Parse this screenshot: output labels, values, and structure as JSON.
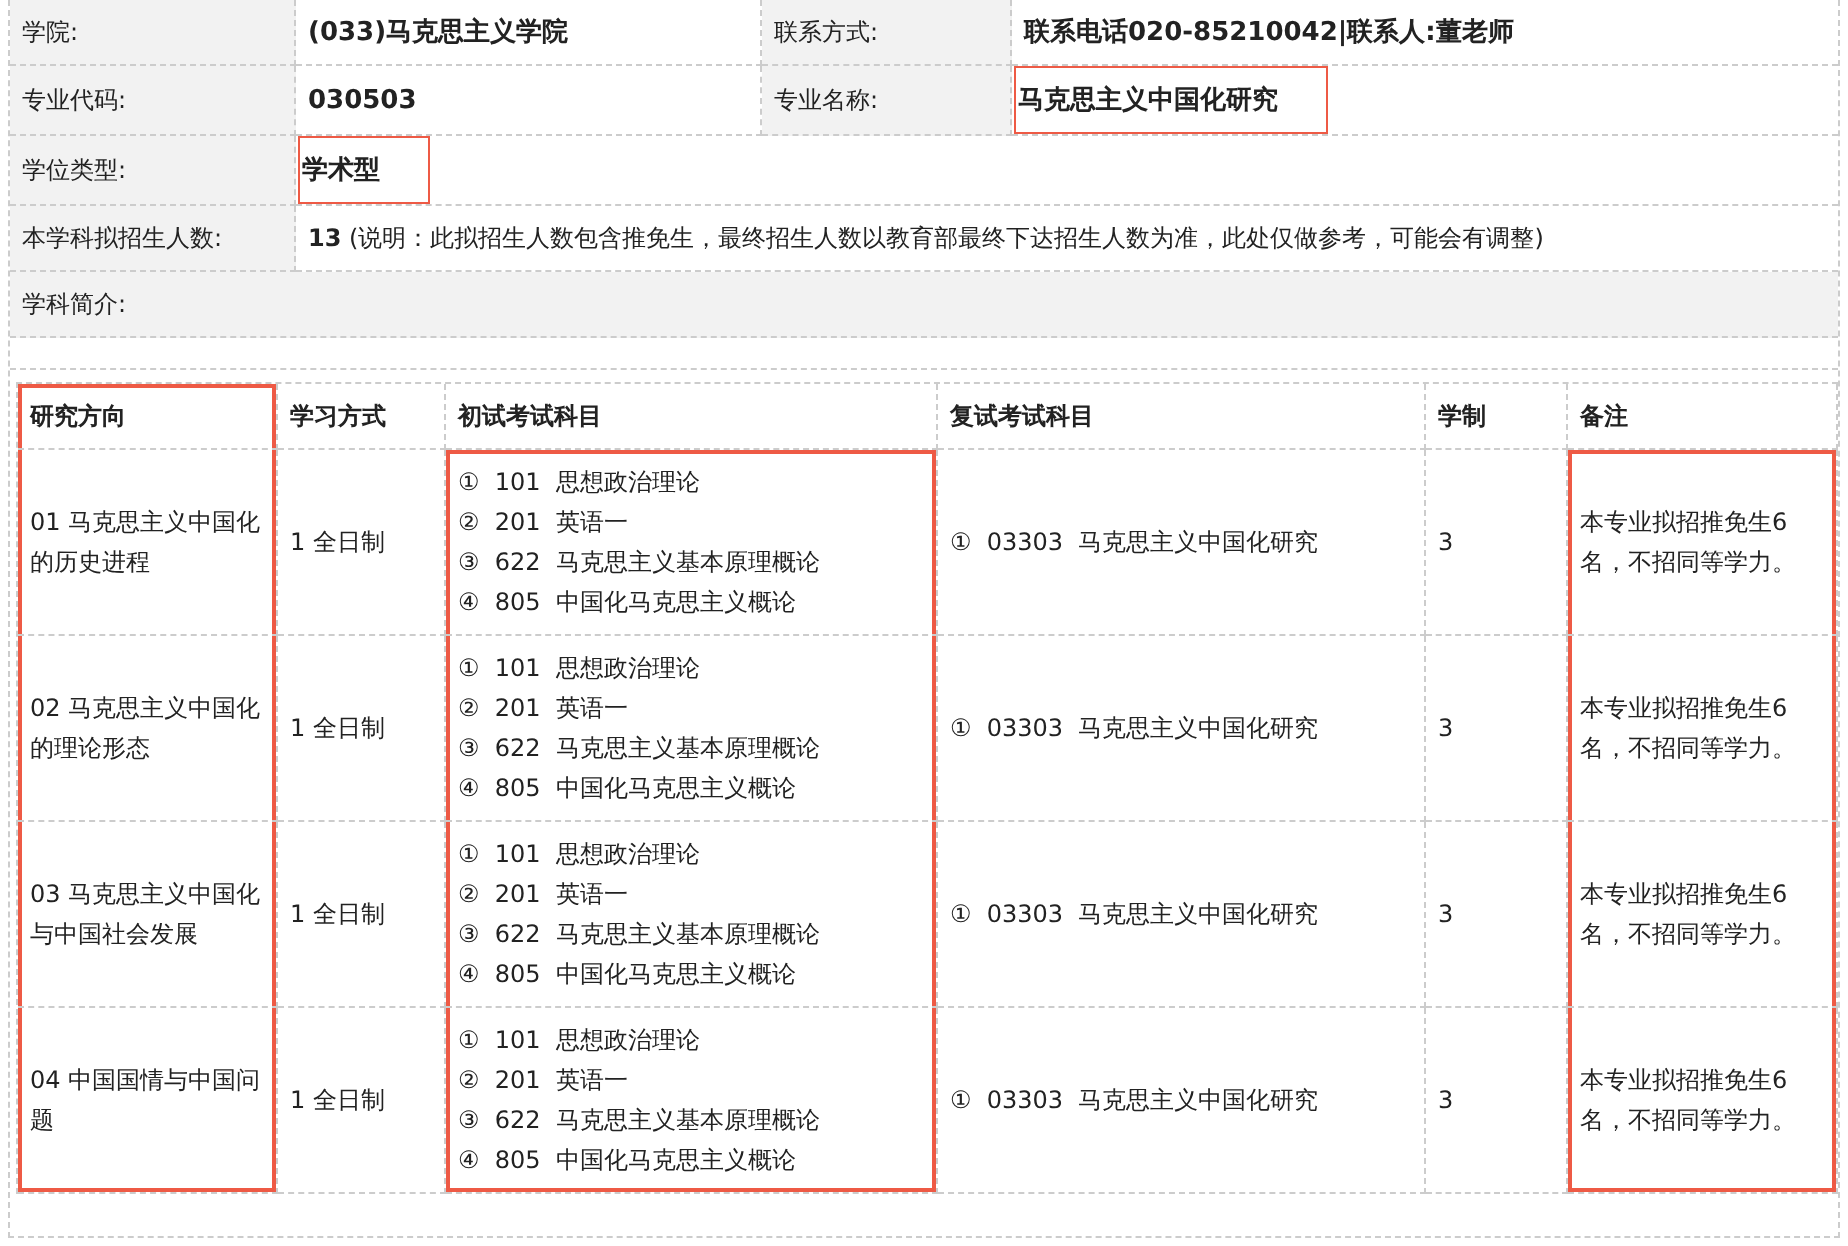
{
  "info": [
    {
      "cells": [
        {
          "kind": "label",
          "text": "学院:"
        },
        {
          "kind": "value",
          "text": "(033)马克思主义学院",
          "highlighted": false
        },
        {
          "kind": "label",
          "text": "联系方式:"
        },
        {
          "kind": "value",
          "text": "联系电话020-85210042|联系人:董老师",
          "highlighted": false
        }
      ]
    },
    {
      "cells": [
        {
          "kind": "label",
          "text": "专业代码:"
        },
        {
          "kind": "value",
          "text": "030503",
          "highlighted": false
        },
        {
          "kind": "label",
          "text": "专业名称:"
        },
        {
          "kind": "value",
          "text": "马克思主义中国化研究",
          "highlighted": true
        }
      ]
    },
    {
      "cells": [
        {
          "kind": "label",
          "text": "学位类型:"
        },
        {
          "kind": "value",
          "text": "学术型",
          "highlighted": true
        }
      ]
    },
    {
      "cells": [
        {
          "kind": "label",
          "text": "本学科拟招生人数:"
        },
        {
          "kind": "note",
          "text": "**13** (说明：此拟招生人数包含推免生，最终招生人数以教育部最终下达招生人数为准，此处仅做参考，可能会有调整)",
          "highlighted": false
        }
      ]
    },
    {
      "cells": [
        {
          "kind": "section",
          "text": "学科简介:"
        }
      ]
    }
  ],
  "table": {
    "columns": [
      {
        "label": "研究方向",
        "highlighted": true,
        "header_highlighted": true
      },
      {
        "label": "学习方式",
        "highlighted": false,
        "header_highlighted": false
      },
      {
        "label": "初试考试科目",
        "highlighted": true,
        "header_highlighted": false
      },
      {
        "label": "复试考试科目",
        "highlighted": false,
        "header_highlighted": false
      },
      {
        "label": "学制",
        "highlighted": false,
        "header_highlighted": false
      },
      {
        "label": "备注",
        "highlighted": true,
        "header_highlighted": false
      }
    ],
    "rows": [
      {
        "direction": "01 马克思主义中国化的历史进程",
        "mode": "1 全日制",
        "exams": [
          "①  101  思想政治理论",
          "②  201  英语一",
          "③  622  马克思主义基本原理概论",
          "④  805  中国化马克思主义概论"
        ],
        "retest": "①  03303  马克思主义中国化研究",
        "years": "3",
        "note": "本专业拟招推免生6名，不招同等学力。"
      },
      {
        "direction": "02 马克思主义中国化的理论形态",
        "mode": "1 全日制",
        "exams": [
          "①  101  思想政治理论",
          "②  201  英语一",
          "③  622  马克思主义基本原理概论",
          "④  805  中国化马克思主义概论"
        ],
        "retest": "①  03303  马克思主义中国化研究",
        "years": "3",
        "note": "本专业拟招推免生6名，不招同等学力。"
      },
      {
        "direction": "03 马克思主义中国化与中国社会发展",
        "mode": "1 全日制",
        "exams": [
          "①  101  思想政治理论",
          "②  201  英语一",
          "③  622  马克思主义基本原理概论",
          "④  805  中国化马克思主义概论"
        ],
        "retest": "①  03303  马克思主义中国化研究",
        "years": "3",
        "note": "本专业拟招推免生6名，不招同等学力。"
      },
      {
        "direction": "04 中国国情与中国问题",
        "mode": "1 全日制",
        "exams": [
          "①  101  思想政治理论",
          "②  201  英语一",
          "③  622  马克思主义基本原理概论",
          "④  805  中国化马克思主义概论"
        ],
        "retest": "①  03303  马克思主义中国化研究",
        "years": "3",
        "note": "本专业拟招推免生6名，不招同等学力。"
      }
    ]
  }
}
